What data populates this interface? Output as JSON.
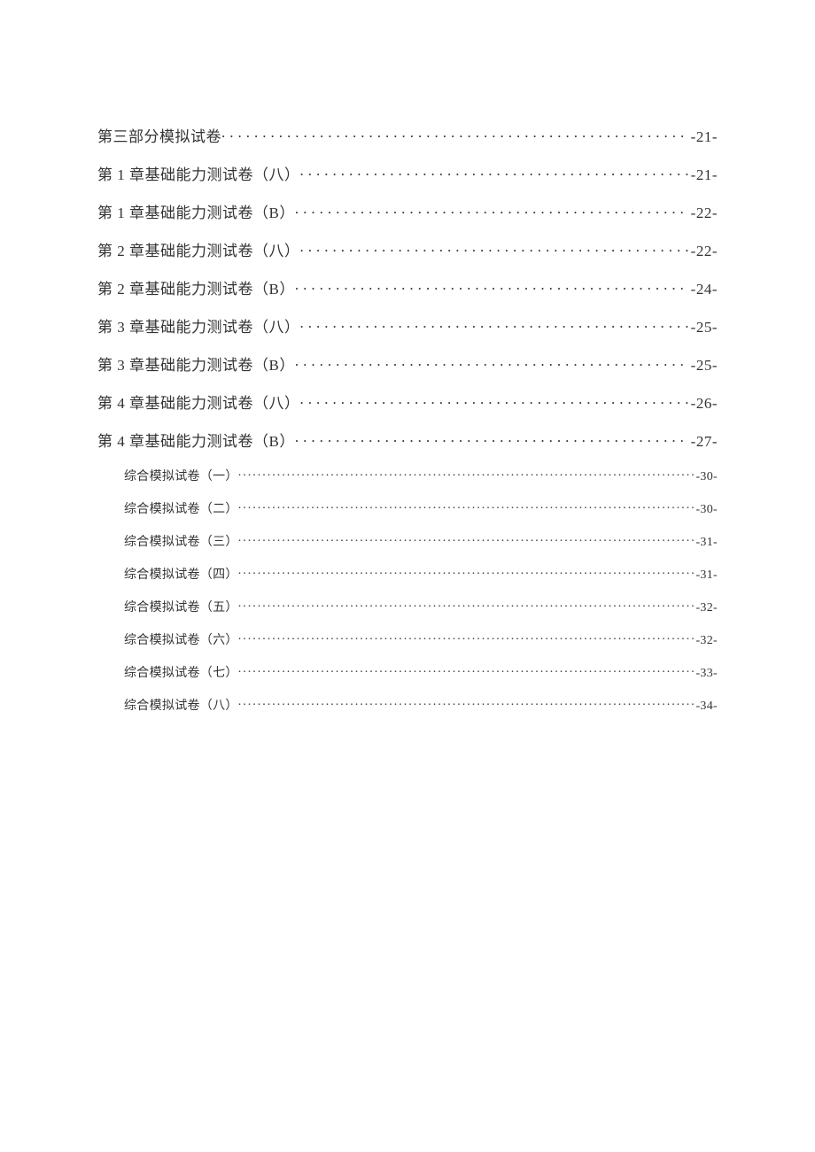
{
  "toc": {
    "entries_level1": [
      {
        "title": "第三部分模拟试卷",
        "page": "-21-"
      },
      {
        "title": "第 1 章基础能力测试卷（八）",
        "page": "-21-"
      },
      {
        "title": "第 1 章基础能力测试卷（B）",
        "page": "-22-"
      },
      {
        "title": "第 2 章基础能力测试卷（八）",
        "page": "-22-"
      },
      {
        "title": "第 2 章基础能力测试卷（B）",
        "page": "-24-"
      },
      {
        "title": "第 3 章基础能力测试卷（八）",
        "page": "-25-"
      },
      {
        "title": "第 3 章基础能力测试卷（B）",
        "page": "-25-"
      },
      {
        "title": "第 4 章基础能力测试卷（八）",
        "page": "-26-"
      },
      {
        "title": "第 4 章基础能力测试卷（B）",
        "page": "-27-"
      }
    ],
    "entries_level2": [
      {
        "title": "综合模拟试卷（一）",
        "page": "-30-"
      },
      {
        "title": "综合模拟试卷（二）",
        "page": "-30-"
      },
      {
        "title": "综合模拟试卷（三）",
        "page": "-31-"
      },
      {
        "title": "综合模拟试卷（四）",
        "page": "-31-"
      },
      {
        "title": "综合模拟试卷（五）",
        "page": "-32-"
      },
      {
        "title": "综合模拟试卷（六）",
        "page": "-32-"
      },
      {
        "title": "综合模拟试卷（七）",
        "page": "-33-"
      },
      {
        "title": "综合模拟试卷（八）",
        "page": "-34-"
      }
    ]
  }
}
